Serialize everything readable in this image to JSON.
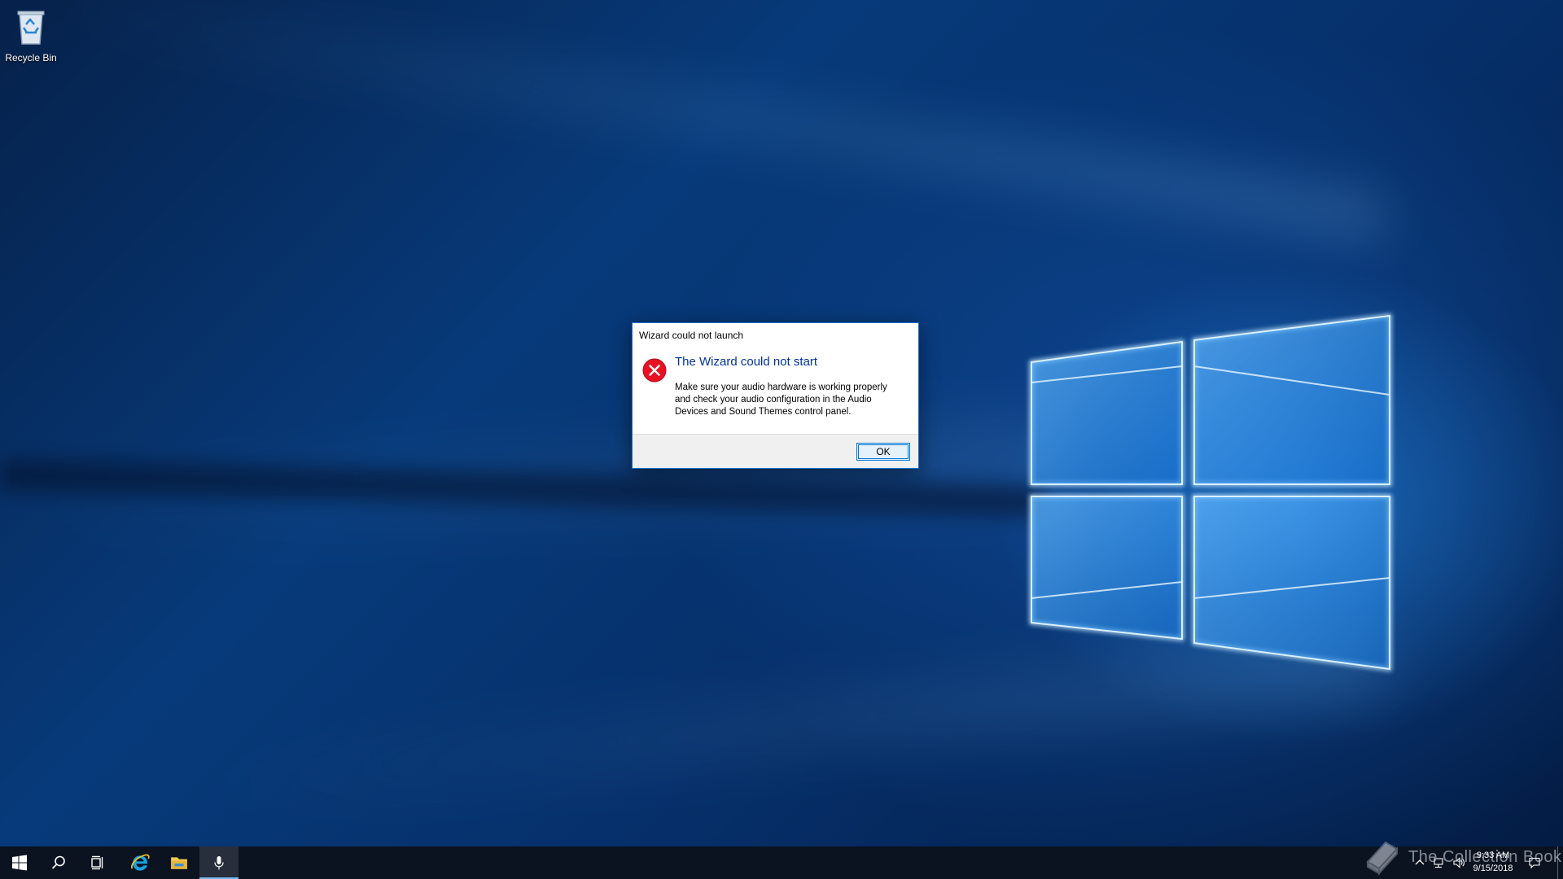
{
  "desktop": {
    "icons": [
      {
        "label": "Recycle Bin",
        "icon": "recycle-bin-icon"
      }
    ]
  },
  "dialog": {
    "title": "Wizard could not launch",
    "heading": "The Wizard could not start",
    "message": "Make sure your audio hardware is working properly and check your audio configuration in the Audio Devices and Sound Themes control panel.",
    "ok_label": "OK",
    "icon": "error-icon",
    "colors": {
      "heading": "#003399",
      "error": "#e81123",
      "border": "#1b6ec2"
    }
  },
  "taskbar": {
    "items": [
      {
        "name": "start",
        "icon": "windows-start-icon"
      },
      {
        "name": "search",
        "icon": "search-icon"
      },
      {
        "name": "task-view",
        "icon": "task-view-icon"
      },
      {
        "name": "internet-explorer",
        "icon": "internet-explorer-icon"
      },
      {
        "name": "file-explorer",
        "icon": "file-explorer-icon"
      },
      {
        "name": "speech-recognition",
        "icon": "microphone-icon",
        "active": true
      }
    ],
    "tray": {
      "icons": [
        "chevron-up-icon",
        "network-icon",
        "volume-icon",
        "notification-icon"
      ],
      "time": "9:33 AM",
      "date": "9/15/2018"
    },
    "watermark": "The Collection Book"
  }
}
